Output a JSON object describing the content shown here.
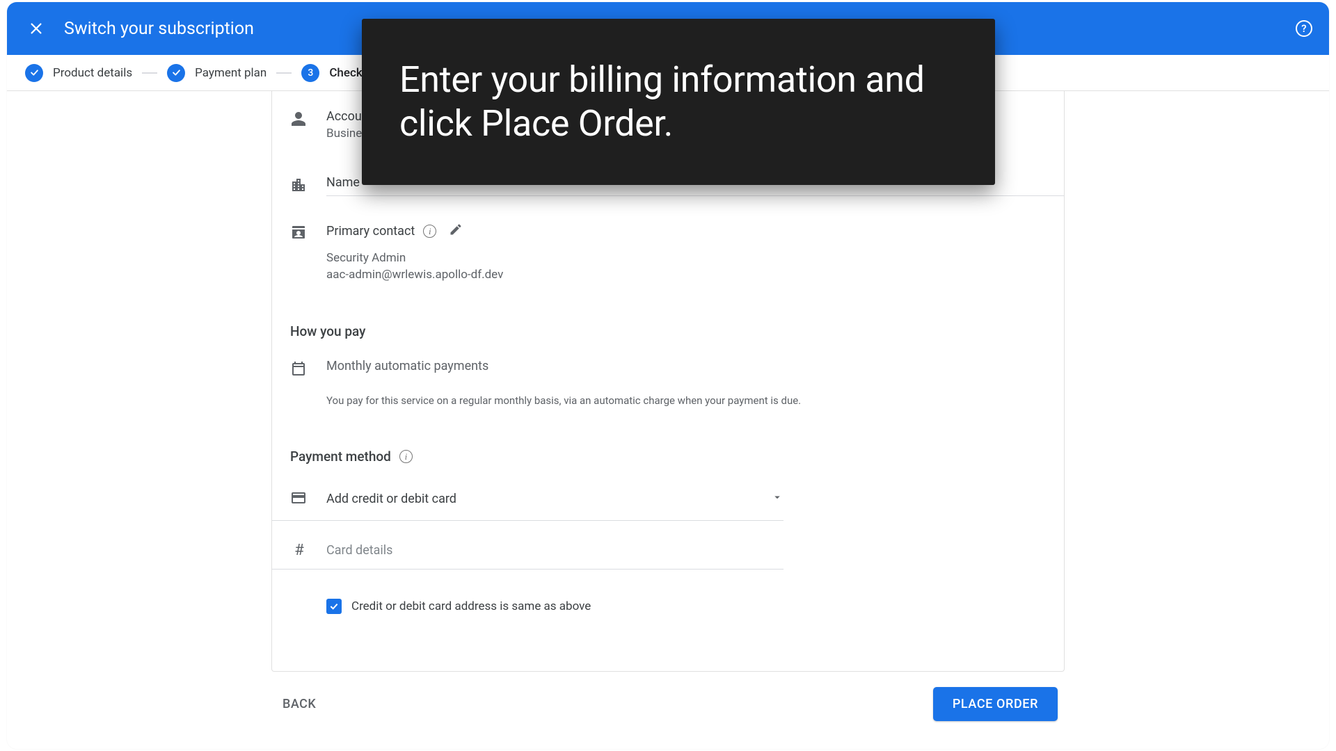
{
  "topbar": {
    "title": "Switch your subscription"
  },
  "stepper": {
    "step1": {
      "label": "Product details"
    },
    "step2": {
      "label": "Payment plan"
    },
    "step3": {
      "label": "Checkout",
      "num": "3"
    }
  },
  "account": {
    "heading_partial": "Accou",
    "type": "Busine",
    "name_address_label": "Name"
  },
  "primary_contact": {
    "label": "Primary contact",
    "name": "Security Admin",
    "email": "aac-admin@wrlewis.apollo-df.dev"
  },
  "how_you_pay": {
    "heading": "How you pay",
    "freq": "Monthly automatic payments",
    "desc": "You pay for this service on a regular monthly basis, via an automatic charge when your payment is due."
  },
  "payment_method": {
    "heading": "Payment method",
    "dropdown_label": "Add credit or debit card",
    "card_details_placeholder": "Card details",
    "same_address_label": "Credit or debit card address is same as above"
  },
  "footer": {
    "back": "BACK",
    "place_order": "PLACE ORDER"
  },
  "overlay": {
    "text": "Enter your billing information and click Place Order."
  }
}
